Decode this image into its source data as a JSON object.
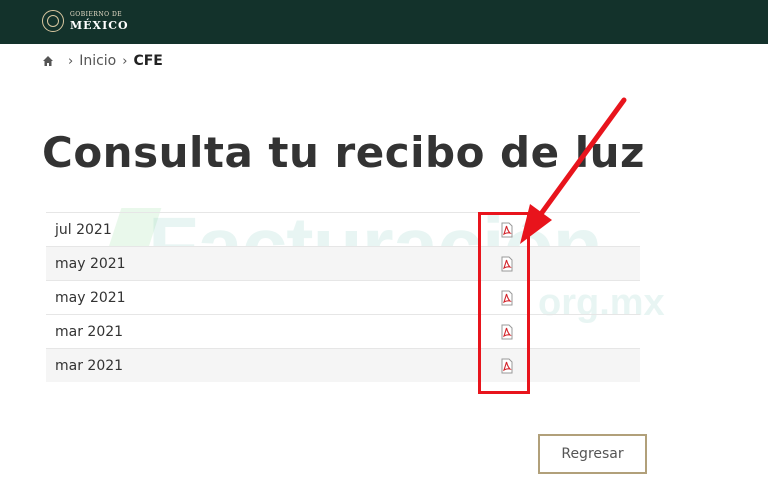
{
  "header": {
    "logo_small": "GOBIERNO DE",
    "logo_big": "MÉXICO",
    "background": "#13322b"
  },
  "breadcrumb": {
    "home_icon": "home-icon",
    "items": [
      "Inicio",
      "CFE"
    ]
  },
  "page": {
    "title": "Consulta tu recibo de luz"
  },
  "watermark": {
    "main": "Facturación",
    "sub": "org.mx"
  },
  "receipts": [
    {
      "date": "jul 2021",
      "icon": "pdf-icon"
    },
    {
      "date": "may 2021",
      "icon": "pdf-icon"
    },
    {
      "date": "may 2021",
      "icon": "pdf-icon"
    },
    {
      "date": "mar 2021",
      "icon": "pdf-icon"
    },
    {
      "date": "mar 2021",
      "icon": "pdf-icon"
    }
  ],
  "annotation": {
    "color": "#e8141c"
  },
  "back_button": {
    "label": "Regresar",
    "border_color": "#b1a07a"
  }
}
